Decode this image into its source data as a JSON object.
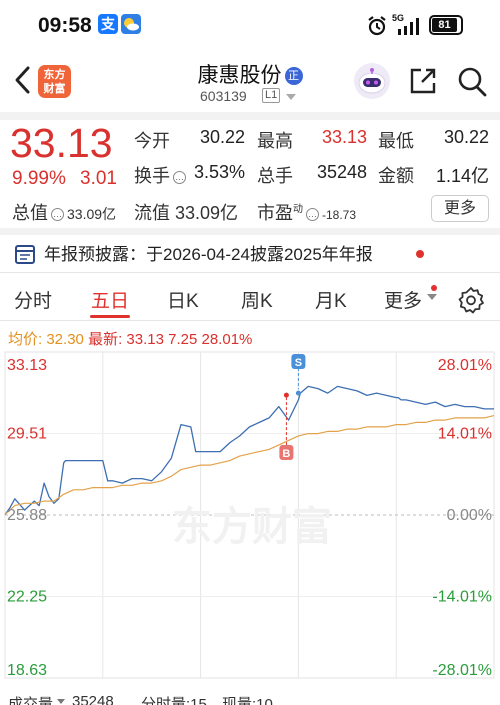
{
  "status_bar": {
    "time": "09:58",
    "network": "5G",
    "battery": "81",
    "app_icons": [
      "alipay-icon",
      "weather-icon"
    ]
  },
  "header": {
    "stock_name": "康惠股份",
    "badge": "正",
    "code": "603139",
    "level": "L1",
    "logo_text": [
      "东方",
      "财富"
    ]
  },
  "quote": {
    "price": "33.13",
    "change_pct": "9.99%",
    "change": "3.01",
    "open_label": "今开",
    "open_value": "30.22",
    "high_label": "最高",
    "high_value": "33.13",
    "low_label": "最低",
    "low_value": "30.22",
    "turnover_label": "换手",
    "turnover_value": "3.53%",
    "volume_label": "总手",
    "volume_value": "35248",
    "amount_label": "金额",
    "amount_value": "1.14亿",
    "mcap_label": "总值",
    "mcap_value": "33.09亿",
    "float_label": "流值",
    "float_value": "33.09亿",
    "pe_label": "市盈",
    "pe_sup": "动",
    "pe_value": "-18.73",
    "more_label": "更多"
  },
  "notice": {
    "text": "年报预披露：于2026-04-24披露2025年年报"
  },
  "tabs": [
    {
      "label": "分时"
    },
    {
      "label": "五日"
    },
    {
      "label": "日K"
    },
    {
      "label": "周K"
    },
    {
      "label": "月K"
    },
    {
      "label": "更多"
    }
  ],
  "avg_bar": {
    "avg_label": "均价:",
    "avg_value": "32.30",
    "latest_label": "最新:",
    "latest_value": "33.13",
    "chg": "7.25",
    "pct": "28.01%"
  },
  "chart_data": {
    "type": "line",
    "title": "",
    "days": 5,
    "y_left_ticks": [
      "33.13",
      "29.51",
      "25.88",
      "22.25",
      "18.63"
    ],
    "y_right_ticks": [
      "28.01%",
      "14.01%",
      "0.00%",
      "-14.01%",
      "-28.01%"
    ],
    "ylim": [
      18.63,
      33.13
    ],
    "reference_price": 25.88,
    "watermark": "东方财富",
    "markers": [
      {
        "label": "S",
        "day": 3,
        "price": 31.3
      },
      {
        "label": "B",
        "day": 3,
        "price": 31.3
      }
    ],
    "series": [
      {
        "role": "price",
        "color": "#3d6fb3",
        "x": [
          0,
          0.05,
          0.1,
          0.2,
          0.3,
          0.35,
          0.4,
          0.45,
          0.5,
          0.55,
          0.6,
          0.62,
          0.7,
          0.8,
          0.9,
          1.0,
          1.05,
          1.1,
          1.2,
          1.3,
          1.4,
          1.5,
          1.6,
          1.7,
          1.8,
          1.9,
          1.95,
          2.0,
          2.1,
          2.2,
          2.3,
          2.4,
          2.5,
          2.6,
          2.7,
          2.8,
          2.9,
          3.0,
          3.02,
          3.1,
          3.2,
          3.3,
          3.4,
          3.5,
          3.6,
          3.7,
          3.8,
          3.9,
          4.0,
          4.02,
          4.05,
          4.1,
          4.2,
          4.3,
          4.4,
          4.5,
          4.6,
          4.7,
          4.8,
          4.9,
          5.0
        ],
        "y": [
          25.9,
          26.2,
          26.6,
          26.1,
          26.5,
          26.3,
          27.3,
          26.7,
          26.4,
          26.6,
          28.2,
          28.3,
          28.3,
          28.3,
          28.3,
          28.3,
          27.4,
          27.4,
          27.3,
          27.5,
          27.5,
          27.4,
          27.8,
          28.4,
          29.9,
          29.8,
          28.7,
          28.7,
          28.7,
          28.7,
          29.1,
          29.4,
          29.8,
          30.0,
          30.2,
          30.7,
          30.1,
          31.0,
          31.3,
          31.6,
          31.5,
          31.3,
          31.6,
          31.5,
          31.4,
          31.2,
          31.3,
          31.2,
          31.1,
          31.1,
          31.0,
          31.0,
          30.9,
          30.8,
          30.9,
          30.7,
          30.8,
          30.7,
          30.7,
          30.6,
          30.6
        ]
      },
      {
        "role": "average",
        "color": "#e3a24a",
        "x": [
          0,
          0.1,
          0.2,
          0.3,
          0.4,
          0.5,
          0.6,
          0.7,
          0.8,
          0.9,
          1.0,
          1.1,
          1.2,
          1.3,
          1.4,
          1.5,
          1.6,
          1.7,
          1.8,
          1.9,
          2.0,
          2.1,
          2.2,
          2.3,
          2.4,
          2.5,
          2.6,
          2.7,
          2.8,
          2.9,
          3.0,
          3.1,
          3.2,
          3.3,
          3.4,
          3.5,
          3.6,
          3.7,
          3.8,
          3.9,
          4.0,
          4.1,
          4.2,
          4.3,
          4.4,
          4.5,
          4.6,
          4.7,
          4.8,
          4.9,
          5.0
        ],
        "y": [
          25.9,
          26.3,
          26.4,
          26.4,
          26.5,
          26.5,
          26.8,
          27.0,
          27.0,
          27.1,
          27.1,
          27.1,
          27.2,
          27.2,
          27.3,
          27.3,
          27.4,
          27.6,
          27.9,
          28.0,
          28.1,
          28.1,
          28.2,
          28.3,
          28.5,
          28.6,
          28.7,
          28.8,
          29.0,
          29.2,
          29.4,
          29.5,
          29.5,
          29.6,
          29.6,
          29.7,
          29.7,
          29.8,
          29.8,
          29.8,
          29.9,
          29.9,
          30.0,
          30.0,
          30.1,
          30.1,
          30.2,
          30.2,
          30.2,
          30.2,
          30.3
        ]
      }
    ]
  },
  "bottom": {
    "vol_label": "成交量",
    "vol_value": "35248",
    "min_label": "分时量:15",
    "cur_label": "现量:10"
  }
}
